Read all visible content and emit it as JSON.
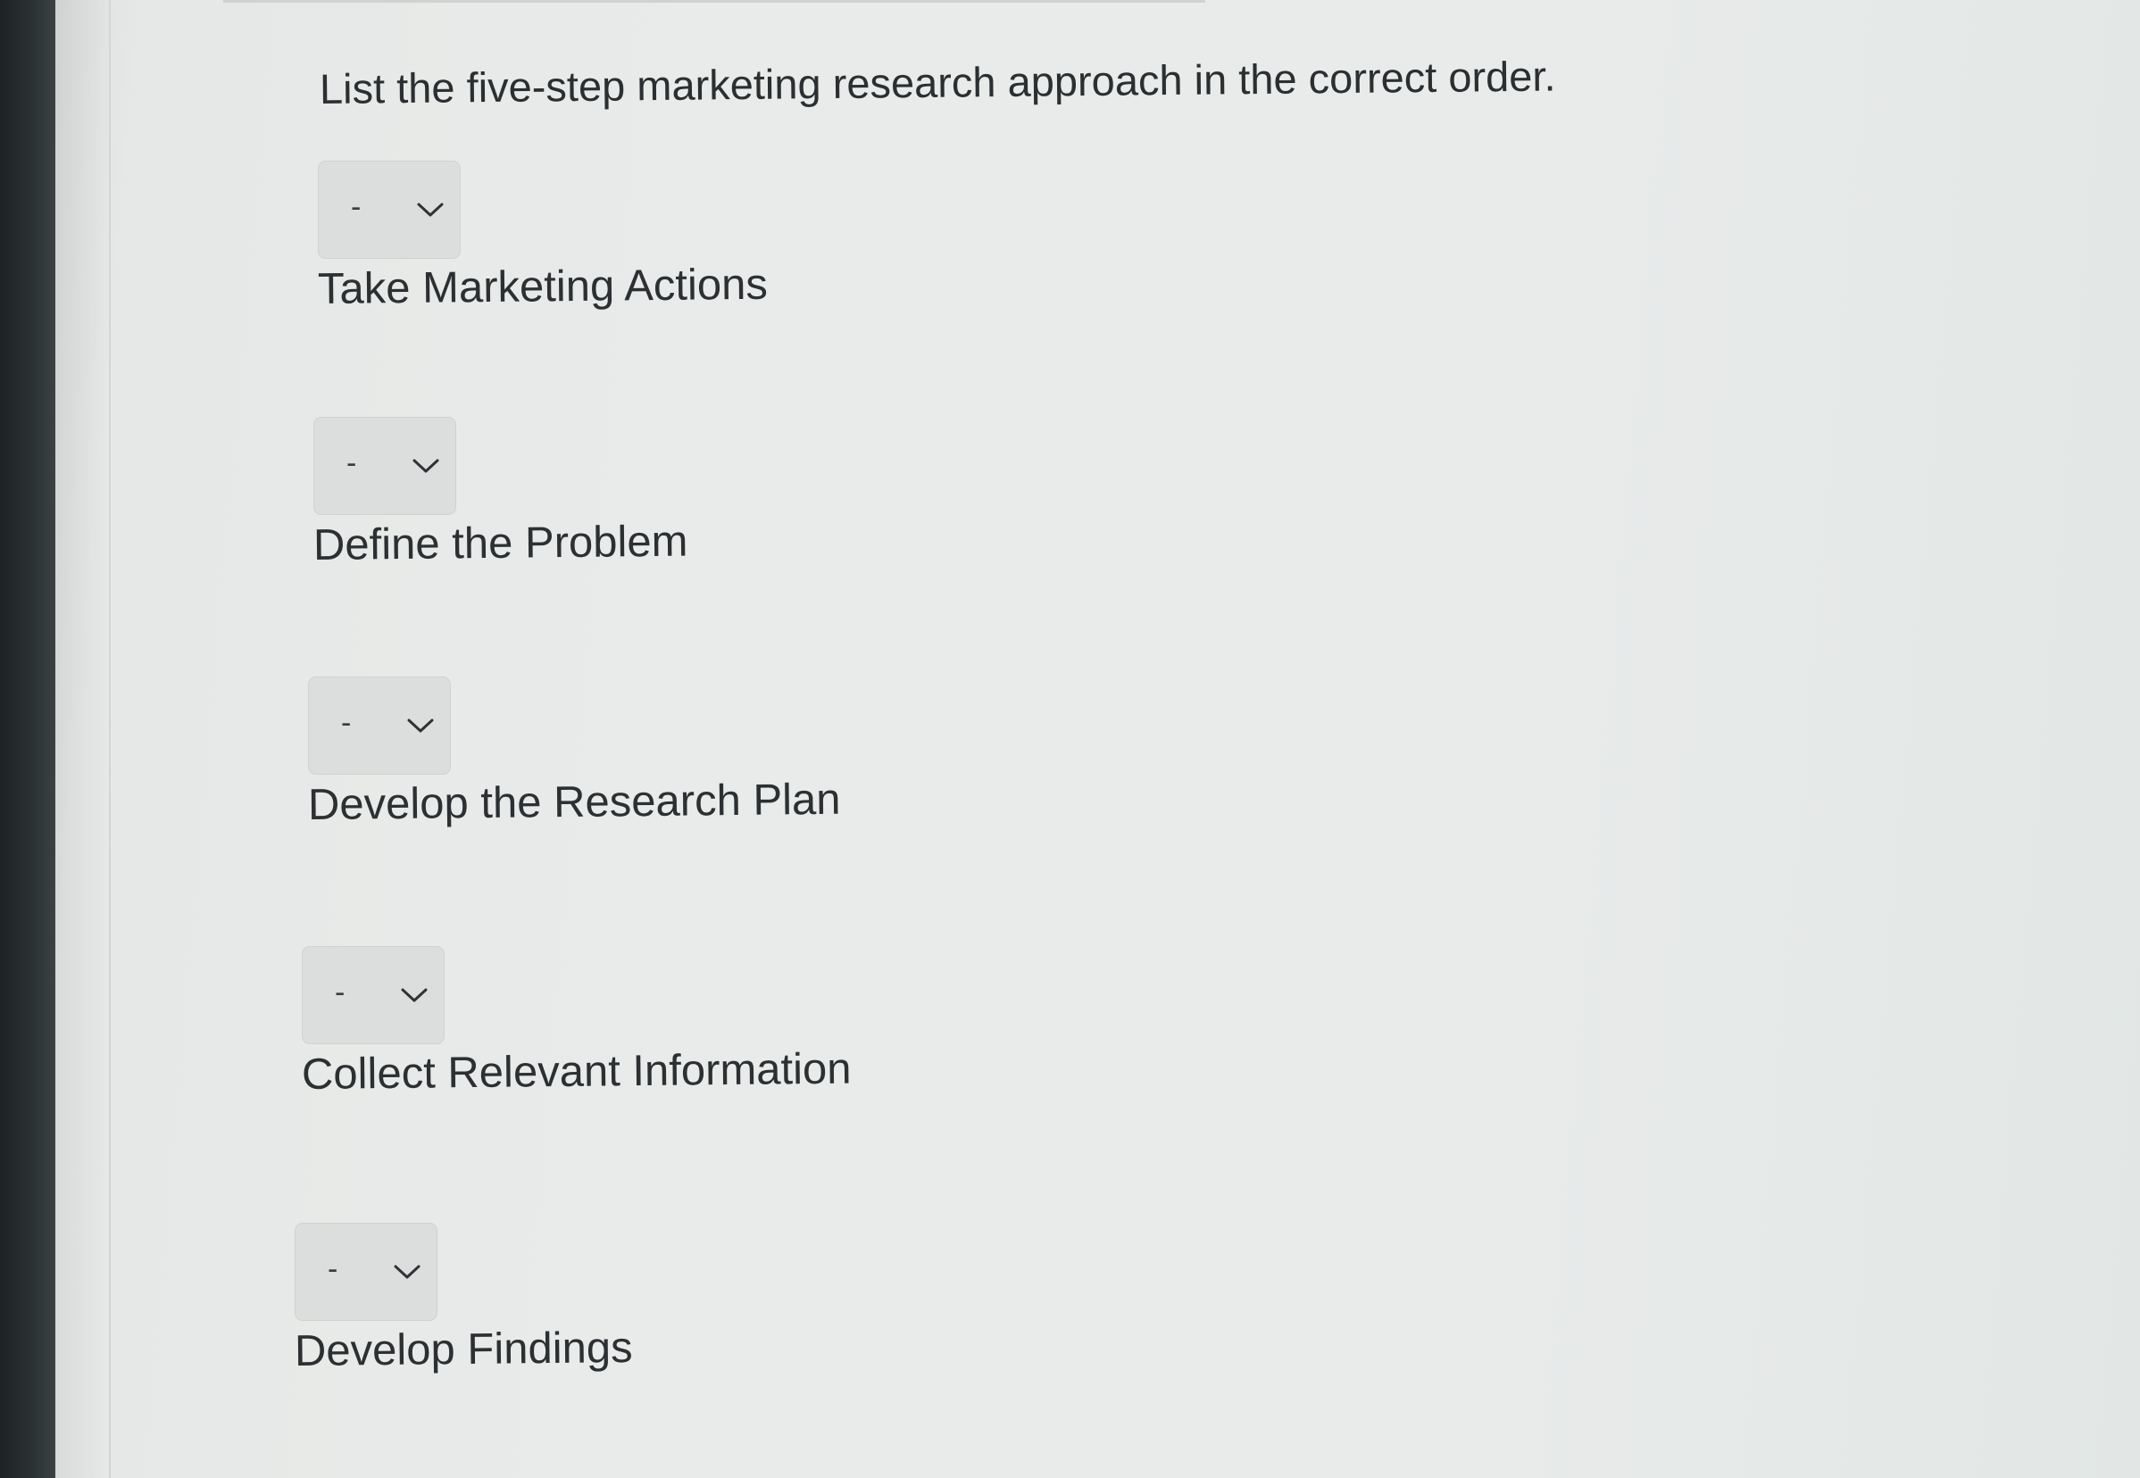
{
  "question": "List the five-step marketing research approach in the correct order.",
  "steps": [
    {
      "selected": "-",
      "label": "Take Marketing Actions"
    },
    {
      "selected": "-",
      "label": "Define the Problem"
    },
    {
      "selected": "-",
      "label": "Develop the Research Plan"
    },
    {
      "selected": "-",
      "label": "Collect Relevant Information"
    },
    {
      "selected": "-",
      "label": "Develop Findings"
    }
  ],
  "icons": {
    "dropdown": "chevron-down-icon"
  },
  "colors": {
    "text": "#2c3032",
    "select_bg": "#dcdedd",
    "page_bg": "#e8ebea",
    "bezel": "#262c2d"
  }
}
